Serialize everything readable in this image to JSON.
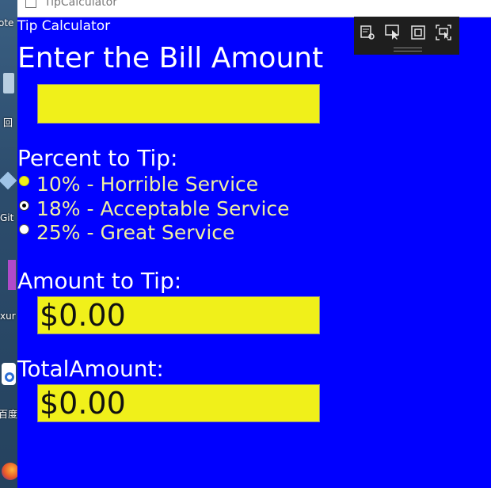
{
  "window": {
    "title": "TipCalculator"
  },
  "desktop": {
    "labels": [
      "ote",
      "回",
      "Git",
      "xur",
      "百度"
    ]
  },
  "app": {
    "title": "Tip Calculator",
    "heading": "Enter the Bill Amount",
    "bill_input": {
      "value": "",
      "placeholder": ""
    },
    "percent_label": "Percent to Tip:",
    "tip_options": [
      {
        "label": "10% - Horrible Service",
        "selected": false
      },
      {
        "label": "18% - Acceptable Service",
        "selected": true
      },
      {
        "label": "25% - Great Service",
        "selected": false
      }
    ],
    "amount_label": "Amount to Tip:",
    "amount_value": "$0.00",
    "total_label": "TotalAmount:",
    "total_value": "$0.00"
  },
  "colors": {
    "background": "#0000ff",
    "field": "#f0f01a",
    "option_text": "#f0f0a0",
    "devbar": "#1e1e1e"
  },
  "devtools": {
    "icons": [
      "live-visual-tree-icon",
      "select-element-icon",
      "display-layout-adorners-icon",
      "track-focus-icon"
    ]
  }
}
